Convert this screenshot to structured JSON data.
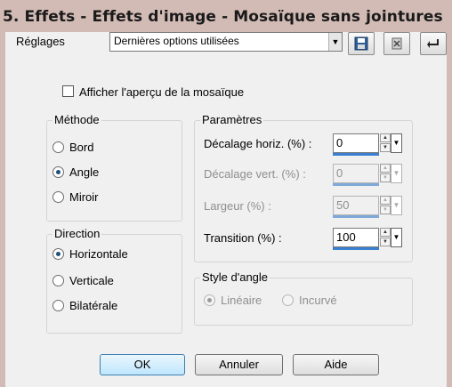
{
  "window": {
    "title": "5. Effets - Effets d'image - Mosaïque sans jointures"
  },
  "preset": {
    "label": "Réglages",
    "value": "Dernières options utilisées",
    "buttons": [
      "save-preset-icon",
      "delete-preset-icon",
      "reset-icon"
    ]
  },
  "preview_checkbox": {
    "label": "Afficher l'aperçu de la mosaïque",
    "checked": false
  },
  "methode": {
    "title": "Méthode",
    "options": [
      {
        "label": "Bord",
        "checked": false
      },
      {
        "label": "Angle",
        "checked": true
      },
      {
        "label": "Miroir",
        "checked": false
      }
    ]
  },
  "direction": {
    "title": "Direction",
    "options": [
      {
        "label": "Horizontale",
        "checked": true
      },
      {
        "label": "Verticale",
        "checked": false
      },
      {
        "label": "Bilatérale",
        "checked": false
      }
    ]
  },
  "parametres": {
    "title": "Paramètres",
    "fields": [
      {
        "label": "Décalage horiz. (%) :",
        "value": "0",
        "enabled": true
      },
      {
        "label": "Décalage vert. (%) :",
        "value": "0",
        "enabled": false
      },
      {
        "label": "Largeur (%) :",
        "value": "50",
        "enabled": false
      },
      {
        "label": "Transition (%) :",
        "value": "100",
        "enabled": true
      }
    ]
  },
  "style_angle": {
    "title": "Style d'angle",
    "options": [
      {
        "label": "Linéaire",
        "checked": true,
        "enabled": false
      },
      {
        "label": "Incurvé",
        "checked": false,
        "enabled": false
      }
    ]
  },
  "buttons": {
    "ok": "OK",
    "cancel": "Annuler",
    "help": "Aide"
  },
  "colors": {
    "title_bg": "#d2bbb4",
    "dialog_bg": "#f0f0f0",
    "radio_dot": "#1f4f7a",
    "spin_bar": "#3a7fd0"
  }
}
